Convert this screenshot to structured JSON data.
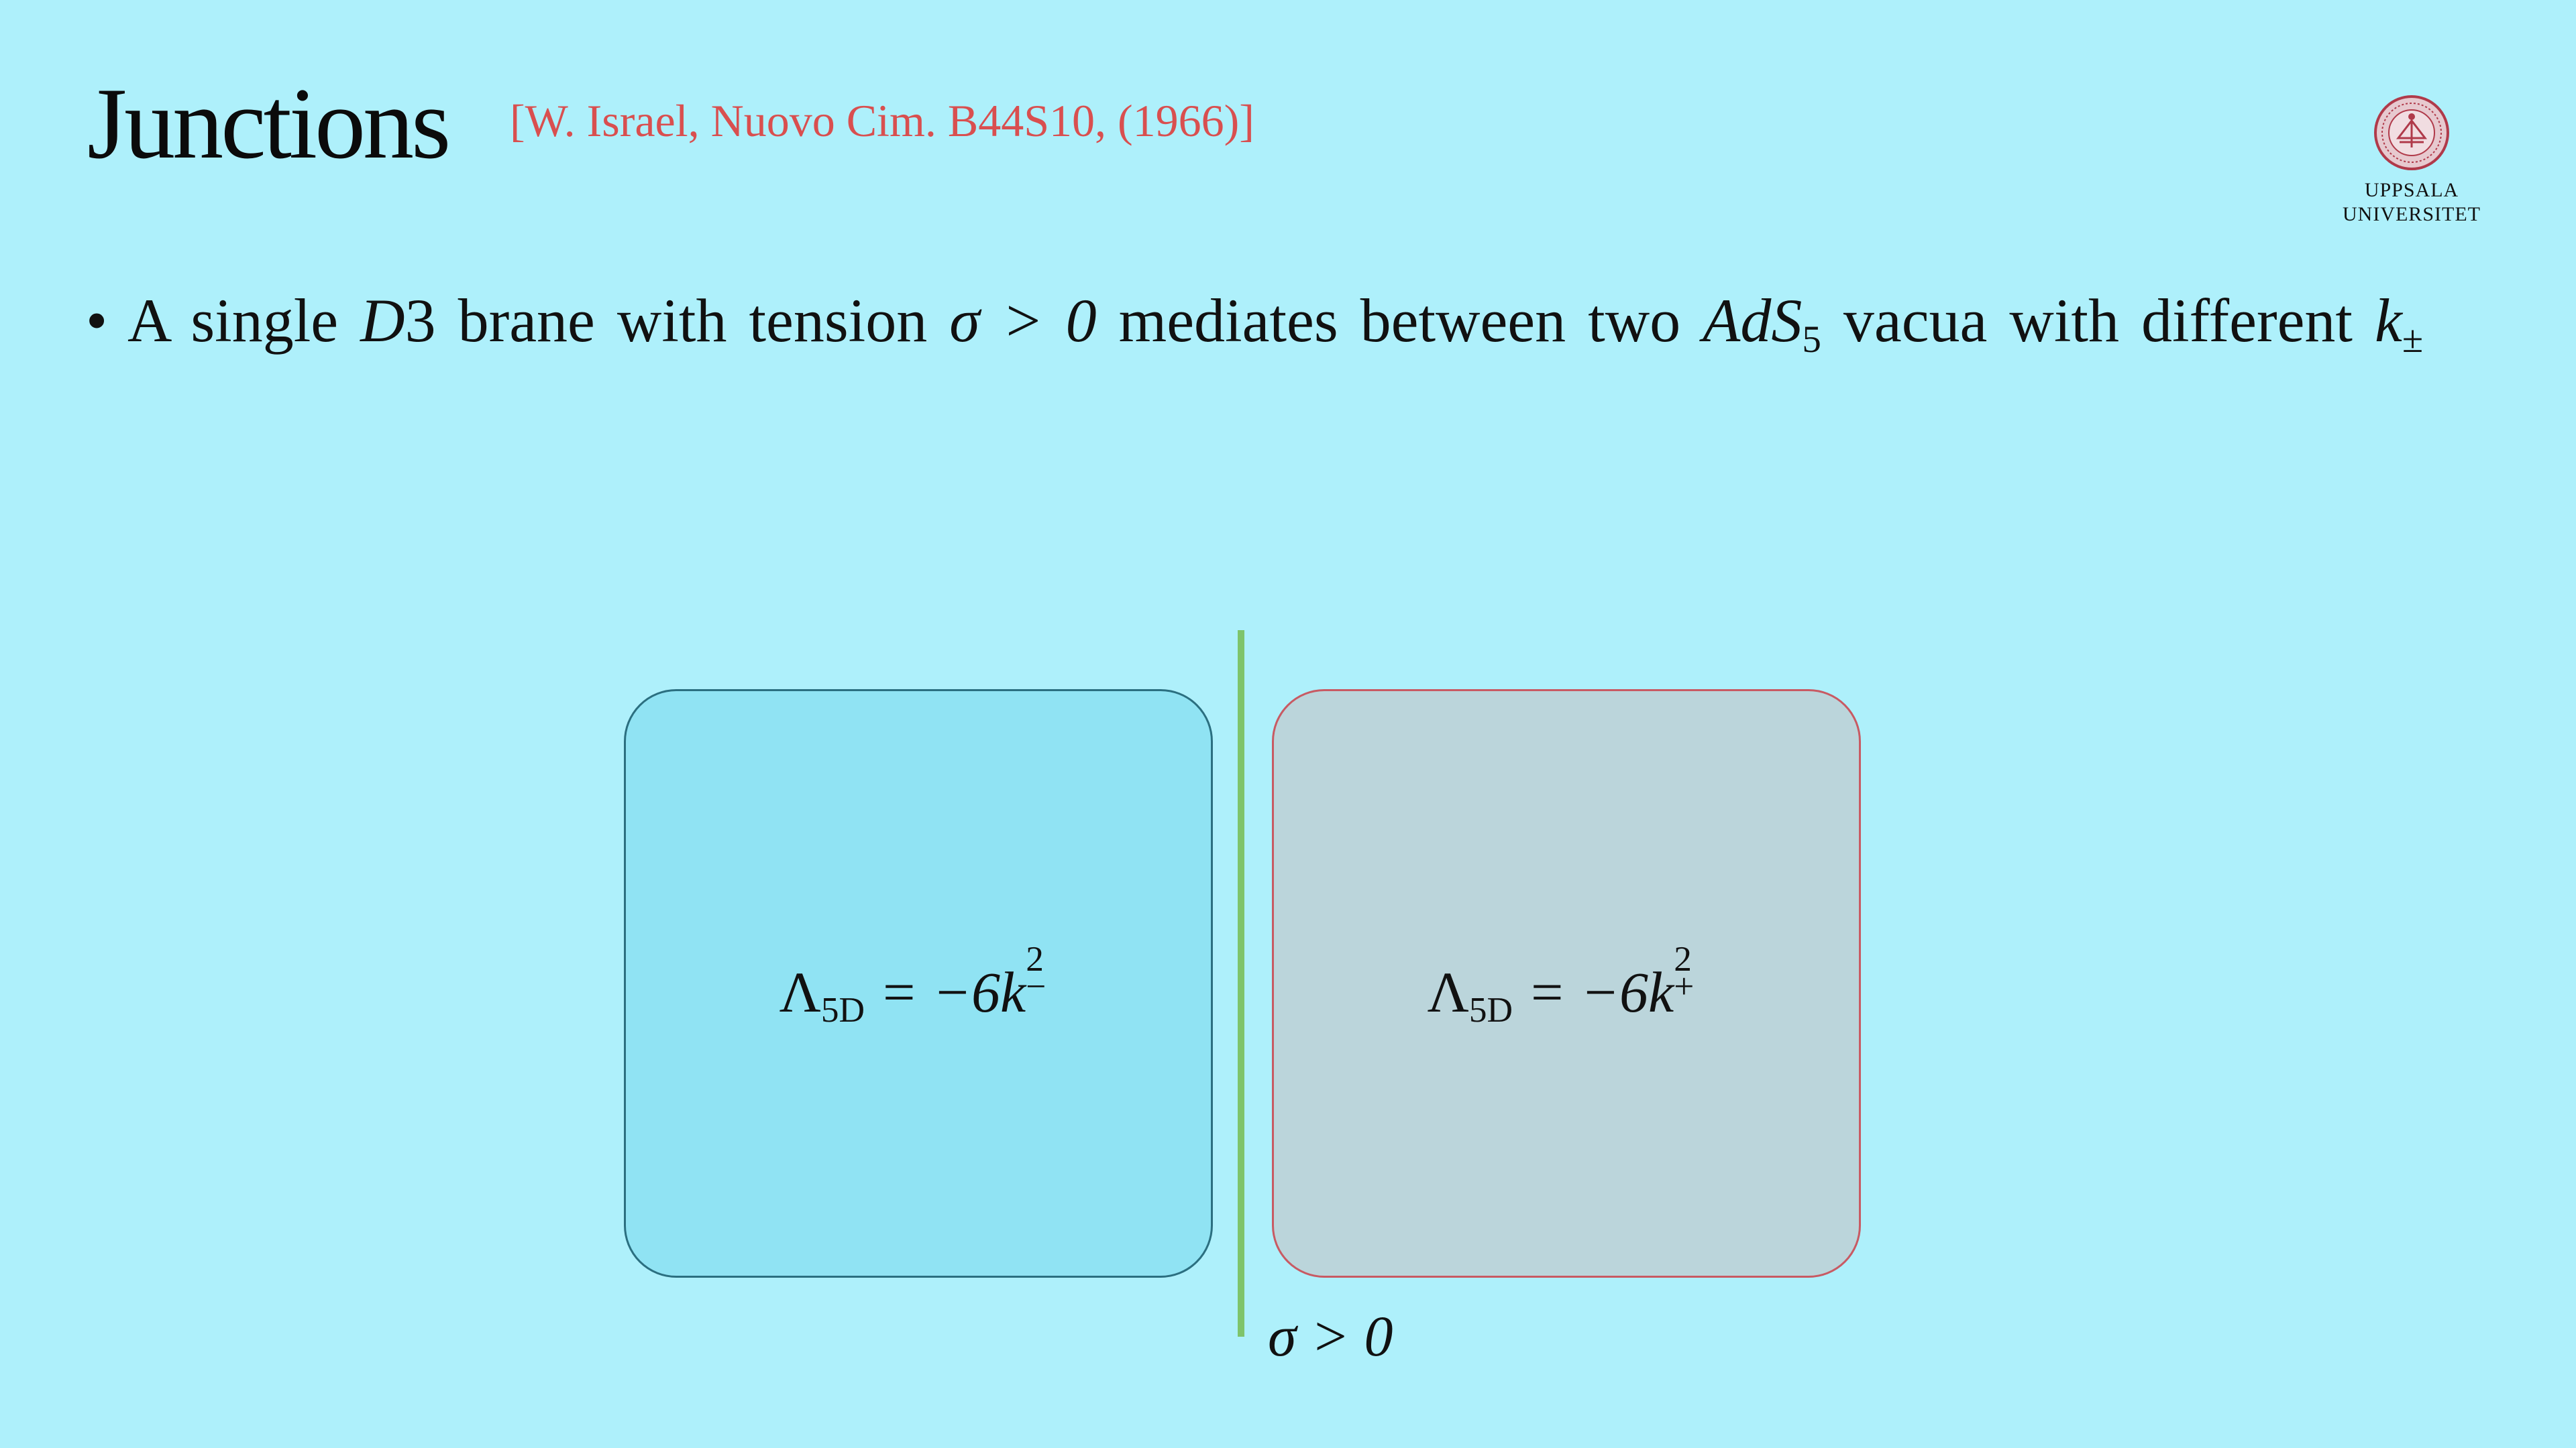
{
  "slide": {
    "title": "Junctions",
    "citation": "[W. Israel, Nuovo Cim. B44S10, (1966)]",
    "logo": {
      "icon": "uppsala-university-seal-icon",
      "line1": "UPPSALA",
      "line2": "UNIVERSITET",
      "color": "#b03a4a"
    },
    "bullet": {
      "symbol": "•",
      "text_a": "A single ",
      "math_d3_italic": "D",
      "math_d3_num": "3",
      "text_b": " brane with tension ",
      "math_sigma": "σ > 0",
      "text_c": " mediates between two ",
      "math_ads": "AdS",
      "math_ads_sub": "5",
      "text_d": " vacua with different ",
      "math_k": "k",
      "math_k_sub": "±"
    },
    "diagram": {
      "left_box": {
        "lambda": "Λ",
        "lambda_sub": "5D",
        "rhs": " = −6k",
        "sup": "2",
        "sub": "−",
        "fill": "#90e3f3",
        "border": "#2b6f80"
      },
      "right_box": {
        "lambda": "Λ",
        "lambda_sub": "5D",
        "rhs": " = −6k",
        "sup": "2",
        "sub": "+",
        "fill": "#bbd5db",
        "border": "#c85a63"
      },
      "brane": {
        "label": "σ > 0",
        "color": "#7ec46b"
      }
    },
    "background": "#aef0fb"
  }
}
